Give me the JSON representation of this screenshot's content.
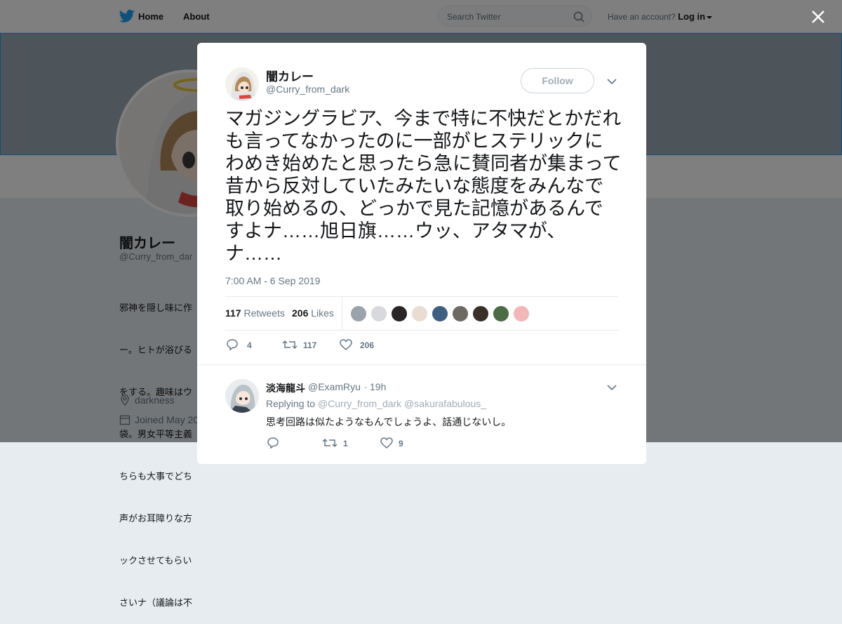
{
  "topbar": {
    "home_label": "Home",
    "about_label": "About",
    "search_placeholder": "Search Twitter",
    "account_prompt": "Have an account?",
    "login_label": "Log in"
  },
  "profile": {
    "name": "闇カレー",
    "handle": "@Curry_from_dar",
    "bio_lines": [
      "邪神を隠し味に作",
      "ー。ヒトが浴びる",
      "をする。趣味はウ",
      "袋。男女平等主義",
      "ちらも大事でどち",
      "声がお耳障りな方",
      "ックさせてもらい",
      "さいナ（議論は不"
    ],
    "location": "darkness",
    "joined": "Joined May 20"
  },
  "tweet": {
    "author_name": "闇カレー",
    "author_handle": "@Curry_from_dark",
    "follow_label": "Follow",
    "text": "マガジングラビア、今まで特に不快だとかだれも言ってなかったのに一部がヒステリックにわめき始めたと思ったら急に賛同者が集まって昔から反対していたみたいな態度をみんなで取り始めるの、どっかで見た記憶があるんですよナ……旭日旗……ウッ、アタマが、ナ……",
    "timestamp": "7:00 AM - 6 Sep 2019",
    "retweets_count": "117",
    "retweets_label": "Retweets",
    "likes_count": "206",
    "likes_label": "Likes",
    "reply_count": "4",
    "retweet_action_count": "117",
    "like_action_count": "206",
    "liker_avatar_colors": [
      "#9aa3ab",
      "#d8d9df",
      "#2b2426",
      "#e9dcd2",
      "#3f5f82",
      "#6e6a62",
      "#3b2f2a",
      "#4a6b45",
      "#f2b7b8"
    ]
  },
  "reply": {
    "author_name": "淡海龍斗",
    "author_handle": "@ExamRyu",
    "separator": "·",
    "time": "19h",
    "replying_to": "Replying to",
    "mention_1": "@Curry_from_dark",
    "mention_2": "@sakurafabulous_",
    "text": "思考回路は似たようなもんでしょうよ、話通じないし。",
    "reply_count": "",
    "retweet_count": "1",
    "like_count": "9"
  },
  "colors": {
    "twitter_blue": "#1da1f2",
    "text_dark": "#14171a",
    "text_muted": "#657786"
  }
}
